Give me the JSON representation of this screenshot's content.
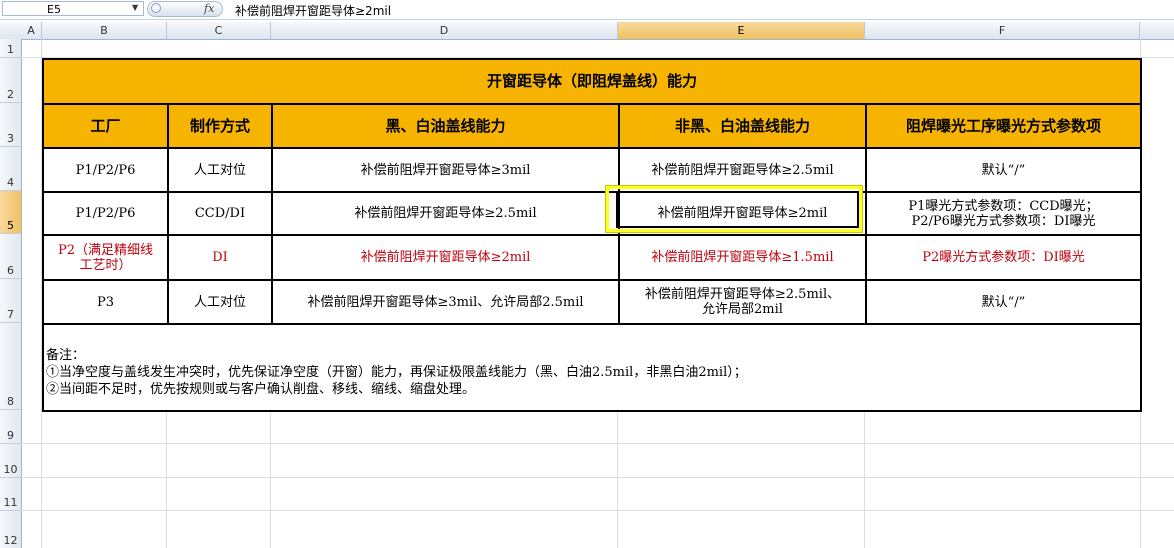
{
  "formula_bar": {
    "cell_ref": "E5",
    "formula": "补偿前阻焊开窗距导体≥2mil",
    "fx": "fx"
  },
  "columns": [
    "A",
    "B",
    "C",
    "D",
    "E",
    "F"
  ],
  "rows": [
    "1",
    "2",
    "3",
    "4",
    "5",
    "6",
    "7",
    "8",
    "9",
    "10",
    "11",
    "12"
  ],
  "sheet": {
    "title": "开窗距导体（即阻焊盖线）能力",
    "headers": [
      "工厂",
      "制作方式",
      "黑、白油盖线能力",
      "非黑、白油盖线能力",
      "阻焊曝光工序曝光方式参数项"
    ],
    "data_rows": [
      [
        "P1/P2/P6",
        "人工对位",
        "补偿前阻焊开窗距导体≥3mil",
        "补偿前阻焊开窗距导体≥2.5mil",
        "默认“/”"
      ],
      [
        "P1/P2/P6",
        "CCD/DI",
        "补偿前阻焊开窗距导体≥2.5mil",
        "补偿前阻焊开窗距导体≥2mil",
        "P1曝光方式参数项：CCD曝光；",
        "P2/P6曝光方式参数项：DI曝光"
      ],
      [
        "P2（满足精细线",
        "工艺时）",
        "DI",
        "补偿前阻焊开窗距导体≥2mil",
        "补偿前阻焊开窗距导体≥1.5mil",
        "P2曝光方式参数项：DI曝光"
      ],
      [
        "P3",
        "人工对位",
        "补偿前阻焊开窗距导体≥3mil、允许局部2.5mil",
        "补偿前阻焊开窗距导体≥2.5mil、",
        "允许局部2mil",
        "默认“/”"
      ]
    ],
    "notes": [
      "备注：",
      "①当净空度与盖线发生冲突时，优先保证净空度（开窗）能力，再保证极限盖线能力（黑、白油2.5mil，非黑白油2mil）；",
      "②当间距不足时，优先按规则或与客户确认削盘、移线、缩线、缩盘处理。"
    ]
  },
  "colors": {
    "header_fill": "#f6b400",
    "red_text": "#c0000c",
    "highlight": "#ffff1e"
  }
}
